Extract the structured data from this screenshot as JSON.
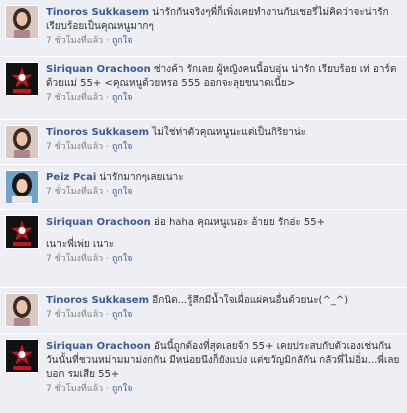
{
  "comments": [
    {
      "avatar": "tinoros-avatar",
      "author": "Tinoros Sukkasem",
      "text": "น่ารักกันจริงๆพี่ก็เพิ่งเคยทำงานกับเชอรี่ไม่คิดว่าจะน่ารัก เรียบร้อยเป็นคุณหนูมากๆ",
      "time": "7 ชั่วโมงที่แล้ว",
      "like": "ถูกใจ"
    },
    {
      "avatar": "virgin-hitz-logo",
      "author": "Siriquan Orachoon",
      "text": "ช่างค้า รักเลย ผู้หญิงคนนี้อบอุ่น น่ารัก เรียบร้อย เท่ อาร์ตด้วยแม่ 55+ <คุณหนูด้วยหรอ 555 ออกจะลุยขนาดเนี้ย>",
      "time": "7 ชั่วโมงที่แล้ว",
      "like": "ถูกใจ"
    },
    {
      "avatar": "tinoros-avatar",
      "author": "Tinoros Sukkasem",
      "text": "ไม่ใช่ท่าตัวคุณหนูนะแต่เป็นกิริยาน่ะ",
      "time": "7 ชั่วโมงที่แล้ว",
      "like": "ถูกใจ"
    },
    {
      "avatar": "peiz-avatar",
      "author": "Peiz Pcai",
      "text": "น่ารักมากๆเลยเนาะ",
      "time": "7 ชั่วโมงที่แล้ว",
      "like": "ถูกใจ"
    },
    {
      "avatar": "virgin-hitz-logo",
      "author": "Siriquan Orachoon",
      "text": "อ่อ haha คุณหนูเนอะ อ้ายย รักอ่ะ 55+",
      "extra": "เนาะพี่เพ่ย เนาะ",
      "time": "7 ชั่วโมงที่แล้ว",
      "like": "ถูกใจ"
    },
    {
      "avatar": "tinoros-avatar",
      "author": "Tinoros Sukkasem",
      "text": "อีกนิด...รู้สึกมีน้ำใจเผื่อแผ่คนอื่นด้วยนะ(^_^)",
      "time": "7 ชั่วโมงที่แล้ว",
      "like": "ถูกใจ"
    },
    {
      "avatar": "virgin-hitz-logo",
      "author": "Siriquan Orachoon",
      "text": "อันนี้ถูกต้องที่สุดเลยจ้า 55+ เคยประสบกับตัวเองเช่นกัน วันนั้นที่ชวนหม่ามมาม่งกกัน มีหน่อยนึงก็ยังแบ่ง แต่ขวัญมิกลักัน กลัวพี่ไม่อิ่ม...พี่เลยบอก รมเสีย 55+",
      "time": "7 ชั่วโมงที่แล้ว",
      "like": "ถูกใจ"
    }
  ],
  "meta_separator": " · ",
  "colors": {
    "background": "#edeff4",
    "author_link": "#3b5998",
    "text": "#333333",
    "meta": "#808080",
    "virgin_red": "#c4161c"
  }
}
